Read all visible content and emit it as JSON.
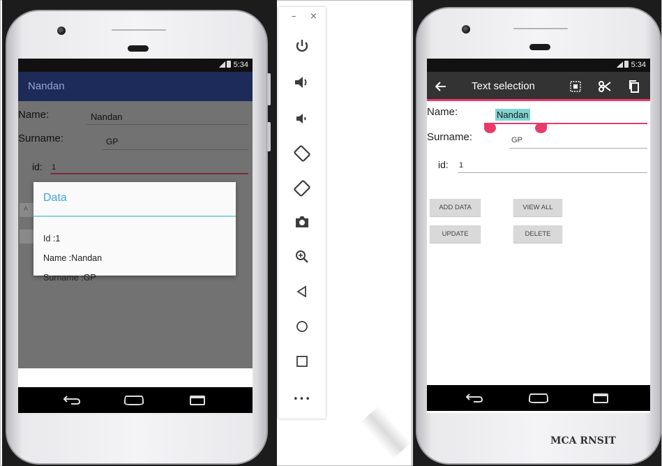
{
  "left_phone": {
    "status_time": "5:34",
    "app_title": "Nandan",
    "form": {
      "name_label": "Name:",
      "name_value": "Nandan",
      "surname_label": "Surname:",
      "surname_value": "GP",
      "id_label": "id:",
      "id_value": "1",
      "hidden_button_fragment": "A"
    },
    "dialog": {
      "title": "Data",
      "id_line": "Id :1",
      "name_line": "Name :Nandan",
      "surname_line": "Surname :GP"
    }
  },
  "emulator_toolbar": {
    "minimize": "–",
    "close": "×",
    "more": "•••"
  },
  "right_phone": {
    "status_time": "5:34",
    "appbar_title": "Text selection",
    "form": {
      "name_label": "Name:",
      "name_value": "Nandan",
      "surname_label": "Surname:",
      "surname_value": "GP",
      "id_label": "id:",
      "id_value": "1"
    },
    "buttons": {
      "add": "ADD DATA",
      "view_all": "VIEW ALL",
      "update": "UPDATE",
      "delete": "DELETE"
    }
  },
  "watermark": "MCA RNSIT",
  "colors": {
    "left_appbar": "#1d2b58",
    "dialog_accent": "#3fa7d6",
    "selection_highlight": "#7fd3d3",
    "selection_handle": "#e93a6b",
    "right_appbar": "#333333"
  }
}
